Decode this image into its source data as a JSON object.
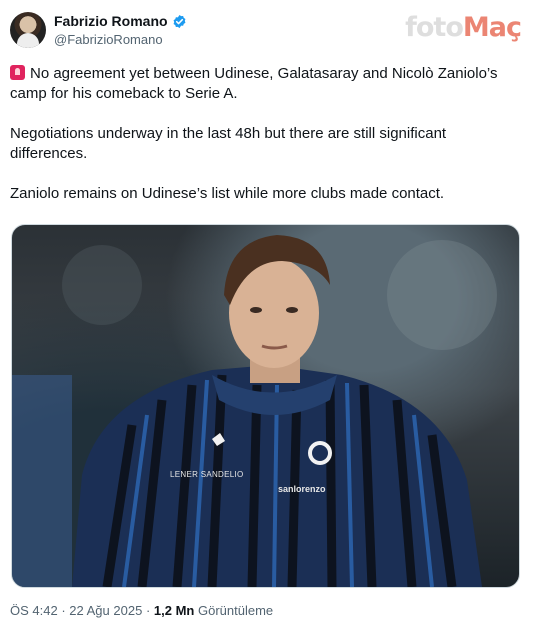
{
  "author": {
    "name": "Fabrizio Romano",
    "handle": "@FabrizioRomano"
  },
  "watermark": {
    "part1": "foto",
    "part2": "Maç"
  },
  "tweet": {
    "line1": "No agreement yet between Udinese, Galatasaray and Nicolò Zaniolo’s camp for his comeback to Serie A.",
    "line2": "Negotiations underway in the last 48h but there are still significant differences.",
    "line3": "Zaniolo remains on Udinese’s list while more clubs made contact."
  },
  "media": {
    "sponsor_left": "LENER SANDELIO",
    "sponsor_right": "sanlorenzo"
  },
  "meta": {
    "time": "ÖS 4:42",
    "date": "22 Ağu 2025",
    "views_count": "1,2 Mn",
    "views_label": "Görüntüleme"
  },
  "colors": {
    "verified": "#1d9bf0",
    "alert": "#e0245e",
    "secondary_text": "#536471"
  }
}
